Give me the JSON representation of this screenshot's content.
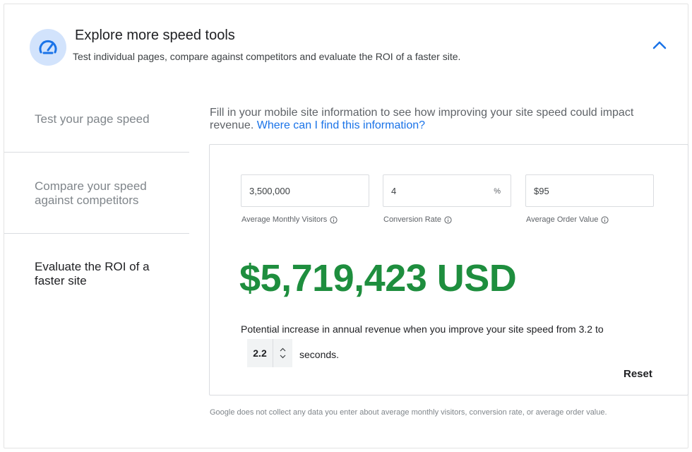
{
  "header": {
    "title": "Explore more speed tools",
    "subtitle": "Test individual pages, compare against competitors and evaluate the ROI of a faster site.",
    "logo_icon": "speedometer-icon",
    "collapse_icon": "chevron-up-icon",
    "accent": "#1a73e8",
    "logo_bg": "#d2e3fc"
  },
  "nav": {
    "items": [
      {
        "label": "Test your page speed"
      },
      {
        "label": "Compare your speed against competitors"
      },
      {
        "label": "Evaluate the ROI of a faster site"
      }
    ]
  },
  "intro": {
    "text": "Fill in your mobile site information to see how improving your site speed could impact revenue.",
    "link": "Where can I find this information?"
  },
  "calculator": {
    "fields": [
      {
        "label": "Average Monthly Visitors",
        "value": "3,500,000"
      },
      {
        "label": "Conversion Rate",
        "value": "4",
        "suffix": "%"
      },
      {
        "label": "Average Order Value",
        "value": "$95"
      }
    ],
    "result": "$5,719,423 USD",
    "result_color": "#1e8e3e",
    "potential_text": "Potential increase in annual revenue when you improve your site speed from 3.2 to",
    "stepper_value": "2.2",
    "seconds_label": "seconds.",
    "reset_label": "Reset"
  },
  "disclaimer": "Google does not collect any data you enter about average monthly visitors, conversion rate, or average order value."
}
